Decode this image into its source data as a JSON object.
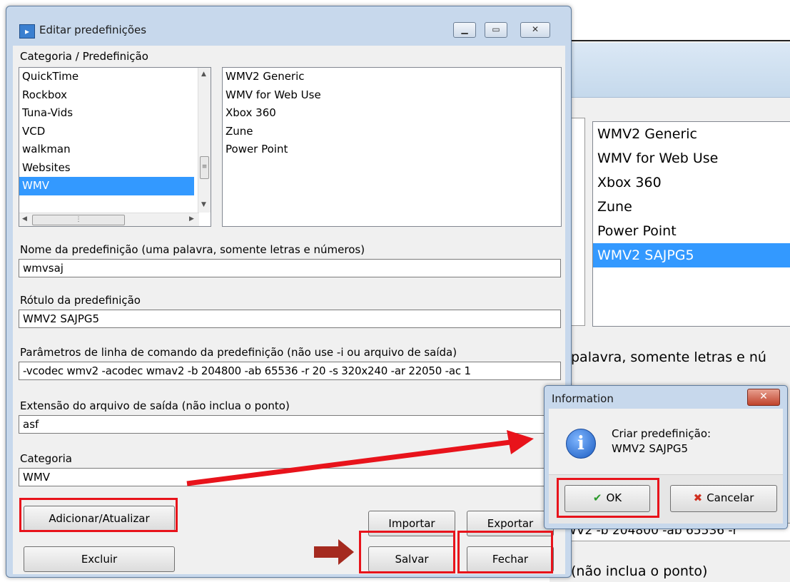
{
  "background_window": {
    "list_items": [
      "WMV2 Generic",
      "WMV for Web Use",
      "Xbox 360",
      "Zune",
      "Power Point",
      "WMV2 SAJPG5"
    ],
    "selected_index": 5,
    "partial_text_1": "palavra, somente letras e nú",
    "partial_text_2": "(não inclua o ponto)",
    "partial_strip": "WV2 -b 204800 -ab 65536 -r"
  },
  "dialog": {
    "title": "Editar predefinições",
    "category_label": "Categoria / Predefinição",
    "categories": [
      "QuickTime",
      "Rockbox",
      "Tuna-Vids",
      "VCD",
      "walkman",
      "Websites",
      "WMV"
    ],
    "selected_category_index": 6,
    "presets": [
      "WMV2 Generic",
      "WMV for Web Use",
      "Xbox 360",
      "Zune",
      "Power Point"
    ],
    "name_label": "Nome da predefinição (uma palavra, somente letras e números)",
    "name_value": "wmvsaj",
    "label_label": "Rótulo da predefinição",
    "label_value": "WMV2 SAJPG5",
    "params_label": "Parâmetros de linha de comando da predefinição (não use -i ou arquivo de saída)",
    "params_value": "-vcodec wmv2 -acodec wmav2 -b 204800 -ab 65536 -r 20 -s 320x240 -ar 22050 -ac 1",
    "ext_label": "Extensão do arquivo de saída (não inclua o ponto)",
    "ext_value": "asf",
    "cat_field_label": "Categoria",
    "cat_field_value": "WMV",
    "buttons": {
      "add_update": "Adicionar/Atualizar",
      "delete": "Excluir",
      "import": "Importar",
      "export": "Exportar",
      "save": "Salvar",
      "close": "Fechar"
    }
  },
  "info_dialog": {
    "title": "Information",
    "message_line1": "Criar predefinição:",
    "message_line2": "WMV2 SAJPG5",
    "ok_label": "OK",
    "cancel_label": "Cancelar"
  },
  "colors": {
    "highlight": "#e8131b",
    "selection": "#3399ff",
    "arrow_dark": "#a52a1f"
  }
}
